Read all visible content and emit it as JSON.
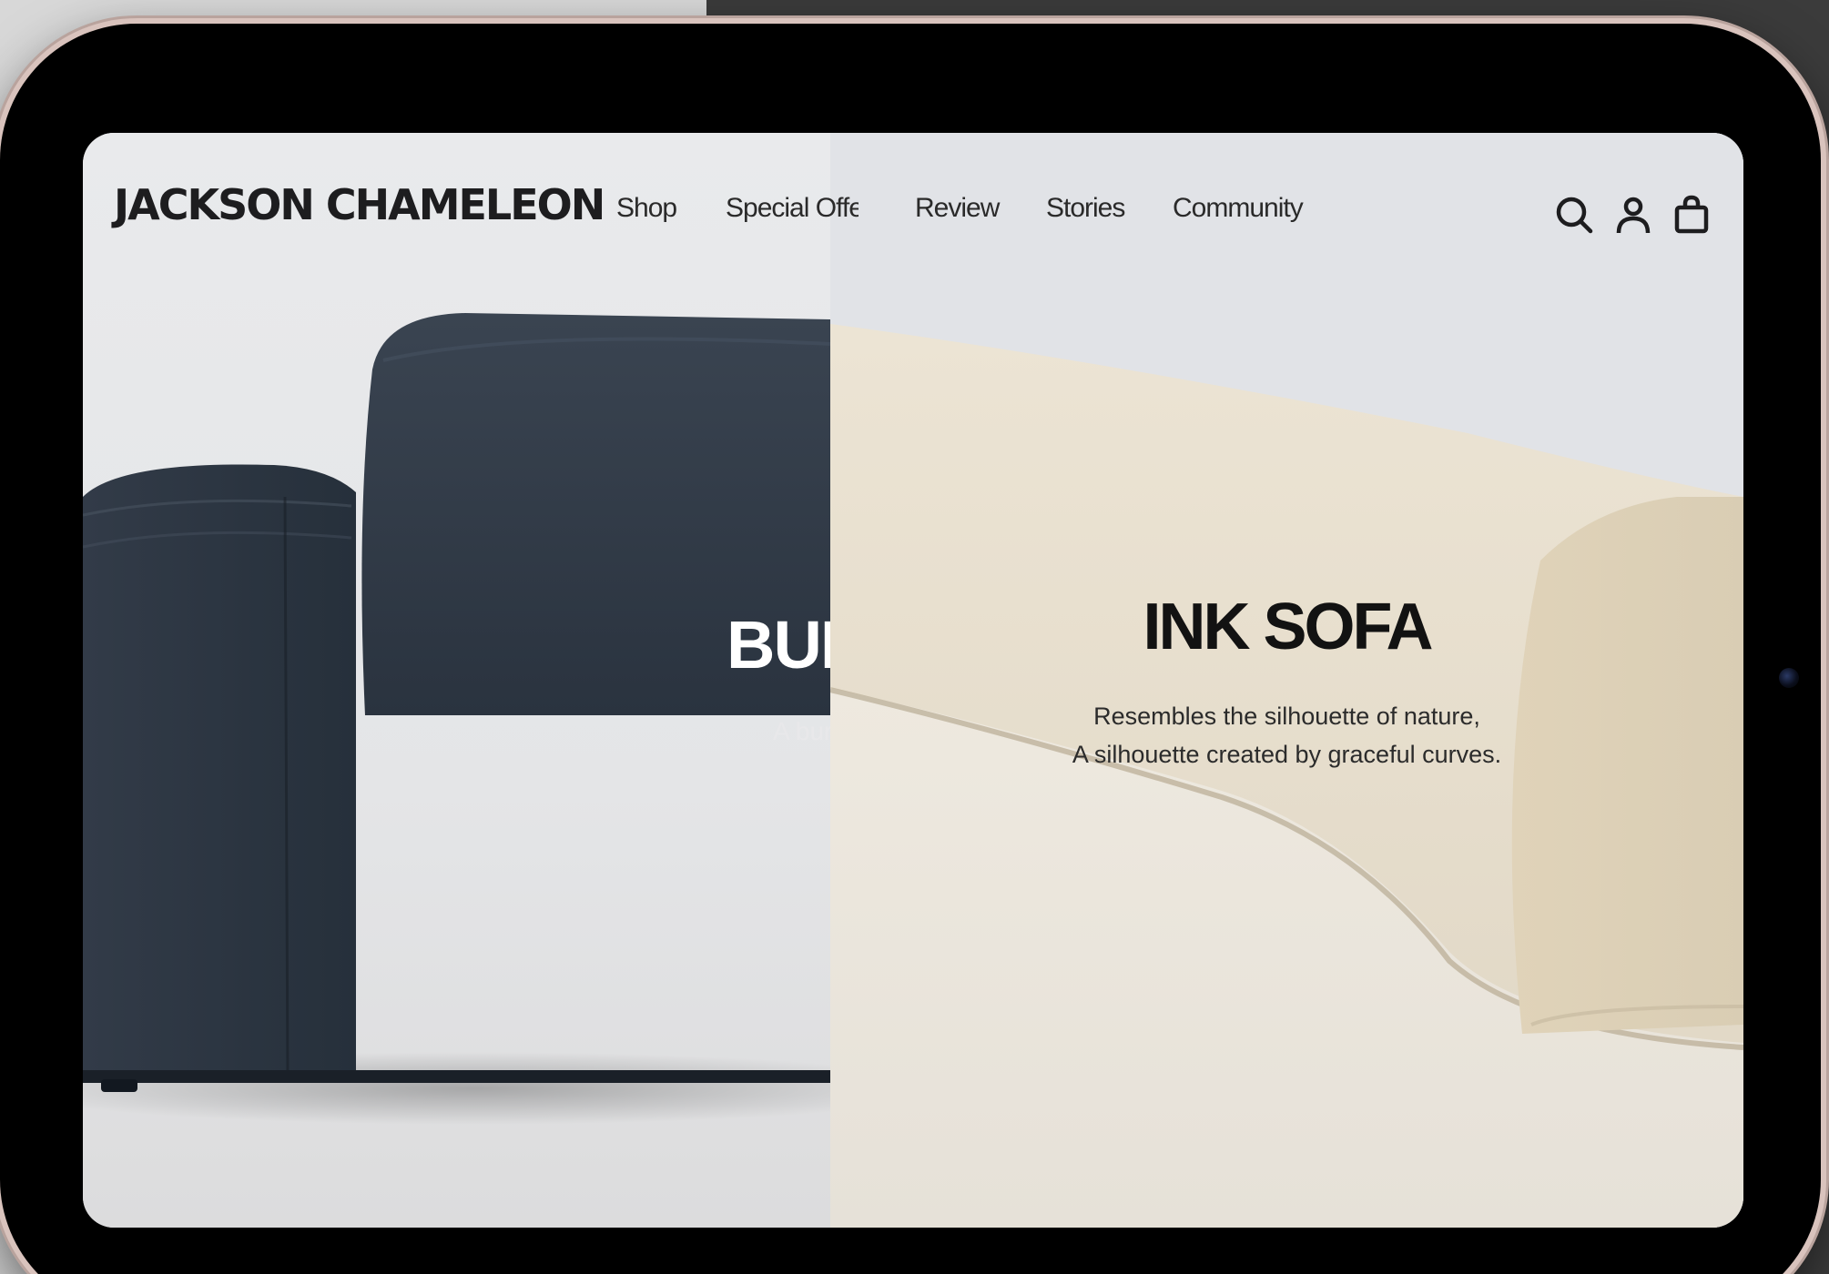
{
  "brand": {
    "logo": "JACKSON CHAMELEON"
  },
  "nav": {
    "items": [
      {
        "label": "Shop"
      },
      {
        "label": "Special Offe"
      },
      {
        "label": "Review"
      },
      {
        "label": "Stories"
      },
      {
        "label": "Community"
      }
    ]
  },
  "header_icons": [
    "search-icon",
    "account-icon",
    "shopping-bag-icon"
  ],
  "hero": {
    "left": {
      "title": "BUI",
      "subtitle": "A bur"
    },
    "right": {
      "title": "INK SOFA",
      "subtitle_line1": "Resembles the silhouette of nature,",
      "subtitle_line2": "A silhouette created by graceful curves."
    }
  },
  "colors": {
    "text_dark": "#1d1d1f",
    "sofa_dark": "#2b3440",
    "sofa_light": "#efe8da",
    "device_bezel": "#000000",
    "device_frame": "#d9c3bd"
  }
}
